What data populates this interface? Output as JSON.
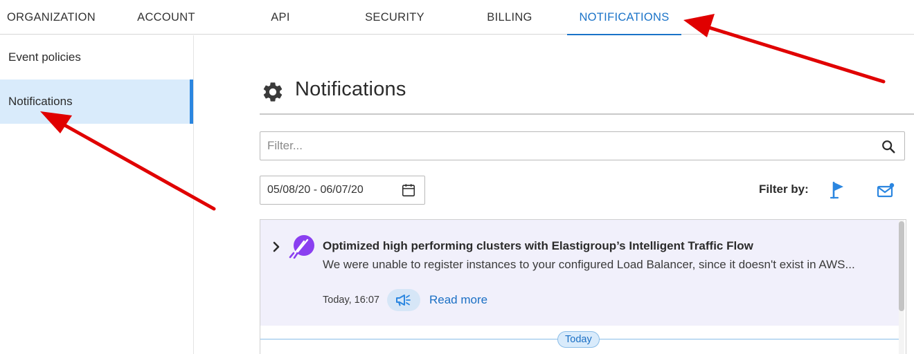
{
  "tabs": [
    {
      "label": "ORGANIZATION"
    },
    {
      "label": "ACCOUNT"
    },
    {
      "label": "API"
    },
    {
      "label": "SECURITY"
    },
    {
      "label": "BILLING"
    },
    {
      "label": "NOTIFICATIONS",
      "active": true
    }
  ],
  "sidebar": {
    "items": [
      {
        "label": "Event policies"
      },
      {
        "label": "Notifications",
        "active": true
      }
    ]
  },
  "main": {
    "title": "Notifications",
    "title_icon": "gear-icon",
    "filter": {
      "placeholder": "Filter...",
      "value": "",
      "icon": "search-icon"
    },
    "date_range": {
      "value": "05/08/20 - 06/07/20",
      "icon": "calendar-icon"
    },
    "filter_by": {
      "label": "Filter by:",
      "icons": [
        "flag-icon",
        "mail-icon"
      ]
    },
    "notifications": [
      {
        "title": "Optimized high performing clusters with Elastigroup’s Intelligent Traffic Flow",
        "body": "We were unable to register instances to your configured Load Balancer, since it doesn't exist in AWS...",
        "time": "Today, 16:07",
        "type_icon": "megaphone-icon",
        "action": "Read more"
      }
    ],
    "group_label": "Today"
  },
  "colors": {
    "accent": "#1a73c8",
    "sidebar_active_bg": "#d9ebfb",
    "card_bg": "#f1f0fb",
    "annotation_arrow": "#e00000"
  }
}
